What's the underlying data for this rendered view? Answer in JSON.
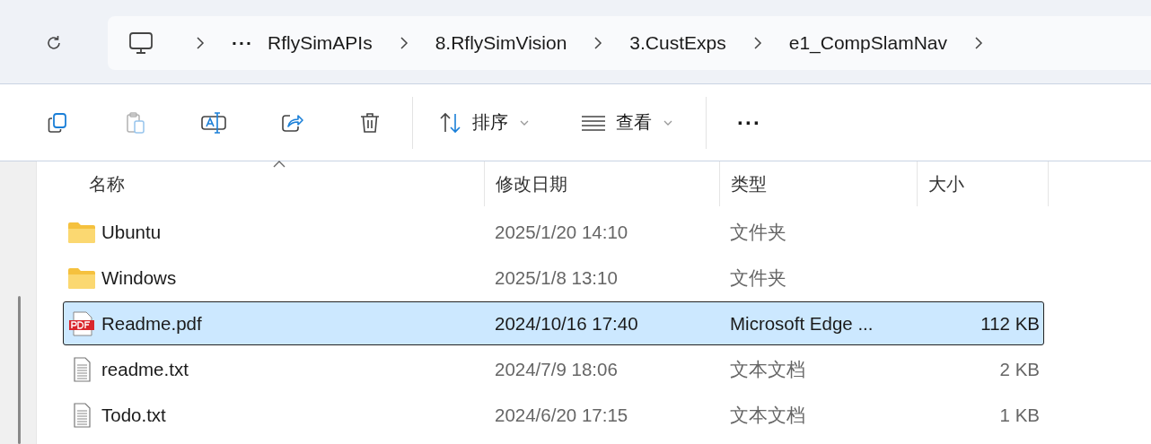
{
  "address_bar": {
    "overflow": "···",
    "segments": [
      "RflySimAPIs",
      "8.RflySimVision",
      "3.CustExps",
      "e1_CompSlamNav"
    ]
  },
  "toolbar": [
    {
      "kind": "copy",
      "disabled": false
    },
    {
      "kind": "paste",
      "disabled": true
    },
    {
      "kind": "rename",
      "disabled": false
    },
    {
      "kind": "share",
      "disabled": false
    },
    {
      "kind": "delete",
      "disabled": false
    },
    {
      "kind": "sort",
      "label": "排序",
      "disabled": false
    },
    {
      "kind": "view",
      "label": "查看",
      "disabled": false
    },
    {
      "kind": "more",
      "label": "···",
      "disabled": false
    }
  ],
  "table": {
    "columns": [
      {
        "label": "名称",
        "sorted": true
      },
      {
        "label": "修改日期",
        "sorted": false
      },
      {
        "label": "类型",
        "sorted": false
      },
      {
        "label": "大小",
        "sorted": false
      }
    ],
    "rows": [
      {
        "kind": "folder",
        "name": "Ubuntu",
        "date": "2025/1/20 14:10",
        "type": "文件夹",
        "selected": false
      },
      {
        "kind": "folder",
        "name": "Windows",
        "date": "2025/1/8 13:10",
        "type": "文件夹",
        "selected": false
      },
      {
        "kind": "pdf",
        "name": "Readme.pdf",
        "date": "2024/10/16 17:40",
        "type": "Microsoft Edge ...",
        "size": "112 KB",
        "selected": true
      },
      {
        "kind": "txt",
        "name": "readme.txt",
        "date": "2024/7/9 18:06",
        "type": "文本文档",
        "size": "2 KB",
        "selected": false
      },
      {
        "kind": "txt",
        "name": "Todo.txt",
        "date": "2024/6/20 17:15",
        "type": "文本文档",
        "size": "1 KB",
        "selected": false
      }
    ]
  }
}
